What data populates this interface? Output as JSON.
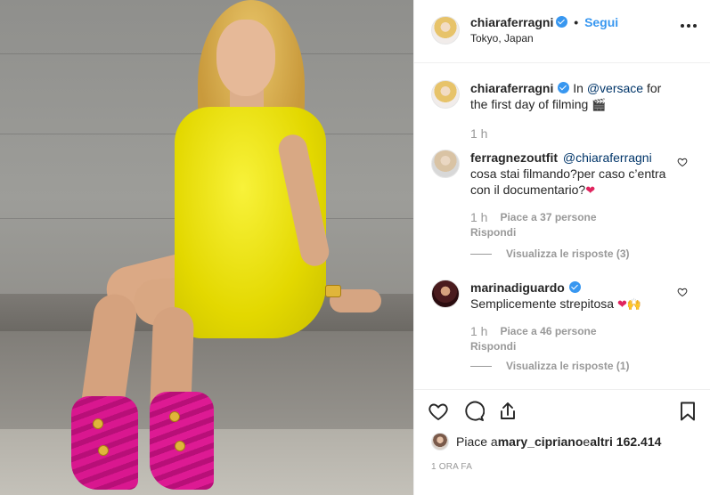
{
  "header": {
    "username": "chiaraferragni",
    "separator": "•",
    "follow_label": "Segui",
    "location": "Tokyo, Japan"
  },
  "caption": {
    "username": "chiaraferragni",
    "text_before": "In ",
    "mention": "@versace",
    "text_after": " for the first day of filming",
    "emoji": "🎬",
    "time": "1 h"
  },
  "comments": [
    {
      "username": "ferragnezoutfit",
      "mention": "@chiaraferragni",
      "text": "cosa stai filmando?per caso c’entra con il documentario?",
      "emoji": "❤",
      "time": "1 h",
      "likes": "Piace a 37 persone",
      "reply": "Rispondi",
      "view_replies": "Visualizza le risposte (3)"
    },
    {
      "username": "marinadiguardo",
      "mention": "",
      "text": "Semplicemente strepitosa",
      "emoji": "❤🙌",
      "time": "1 h",
      "likes": "Piace a 46 persone",
      "reply": "Rispondi",
      "view_replies": "Visualizza le risposte (1)"
    }
  ],
  "likes_row": {
    "prefix": "Piace a ",
    "user": "mary_cipriano",
    "middle": " e ",
    "others": "altri 162.414"
  },
  "date": "1 ora fa",
  "icons": {
    "like": "heart-icon",
    "comment": "comment-icon",
    "share": "share-icon",
    "save": "bookmark-icon",
    "more": "more-dots-icon",
    "verified": "verified-badge-icon"
  },
  "colors": {
    "link": "#3897f0",
    "verified": "#3897f0",
    "muted": "#999999",
    "text": "#262626",
    "mention": "#003569"
  }
}
